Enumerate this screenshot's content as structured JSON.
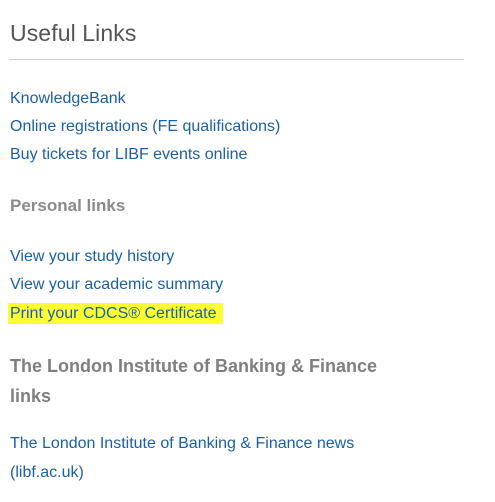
{
  "panel": {
    "title": "Useful Links"
  },
  "useful_links": [
    "KnowledgeBank",
    "Online registrations (FE qualifications)",
    "Buy tickets for LIBF events online"
  ],
  "personal": {
    "heading": "Personal links",
    "links": [
      "View your study history",
      "View your academic summary",
      "Print your CDCS® Certificate"
    ]
  },
  "libf": {
    "heading_line1": "The London Institute of Banking & Finance",
    "heading_line2": "links",
    "link_line1": "The London Institute of Banking & Finance news",
    "link_line2": "(libf.ac.uk)"
  },
  "colors": {
    "link": "#1b5fa6",
    "heading": "#8a8a8a",
    "highlight": "#ffff33"
  }
}
